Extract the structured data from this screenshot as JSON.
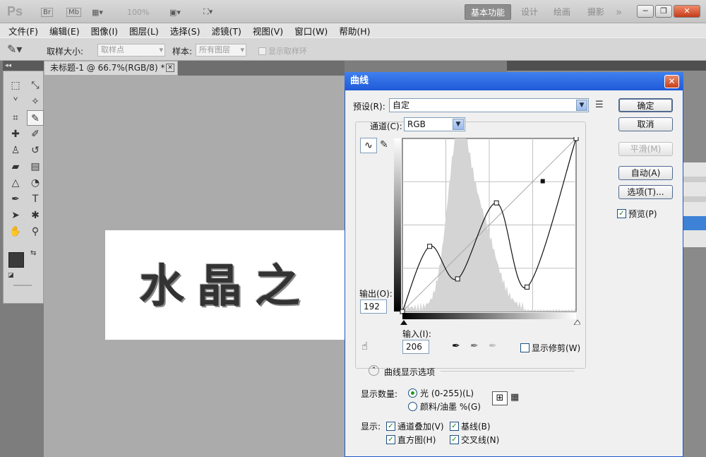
{
  "app": {
    "logo": "Ps",
    "title_icons": [
      "Br",
      "Mb"
    ],
    "zoom": "100%",
    "workspaces": [
      "基本功能",
      "设计",
      "绘画",
      "摄影"
    ],
    "more": "»",
    "window_controls": [
      "─",
      "❐",
      "✕"
    ]
  },
  "menu": [
    "文件(F)",
    "编辑(E)",
    "图像(I)",
    "图层(L)",
    "选择(S)",
    "滤镜(T)",
    "视图(V)",
    "窗口(W)",
    "帮助(H)"
  ],
  "options": {
    "sample_size_label": "取样大小:",
    "sample_size_value": "取样点",
    "sample_label": "样本:",
    "sample_value": "所有图层",
    "show_ring": "显示取样环"
  },
  "document": {
    "tab": "未标题-1 @ 66.7%(RGB/8) *",
    "text": "水晶之"
  },
  "dialog": {
    "title": "曲线",
    "preset_label": "预设(R):",
    "preset_value": "自定",
    "channel_label": "通道(C):",
    "channel_value": "RGB",
    "output_label": "输出(O):",
    "output_value": "192",
    "input_label": "输入(I):",
    "input_value": "206",
    "show_clipping": "显示修剪(W)",
    "display_options": "曲线显示选项",
    "amount_label": "显示数量:",
    "light": "光 (0-255)(L)",
    "pigment": "颜料/油墨 %(G)",
    "show_label": "显示:",
    "channel_overlays": "通道叠加(V)",
    "baseline": "基线(B)",
    "histogram": "直方图(H)",
    "intersection": "交叉线(N)",
    "buttons": {
      "ok": "确定",
      "cancel": "取消",
      "smooth": "平滑(M)",
      "auto": "自动(A)",
      "options": "选项(T)...",
      "preview": "预览(P)"
    },
    "curve_points": [
      [
        0,
        0
      ],
      [
        40,
        96
      ],
      [
        81,
        48
      ],
      [
        138,
        160
      ],
      [
        183,
        36
      ],
      [
        255,
        255
      ]
    ],
    "selected_point": [
      206,
      192
    ]
  }
}
